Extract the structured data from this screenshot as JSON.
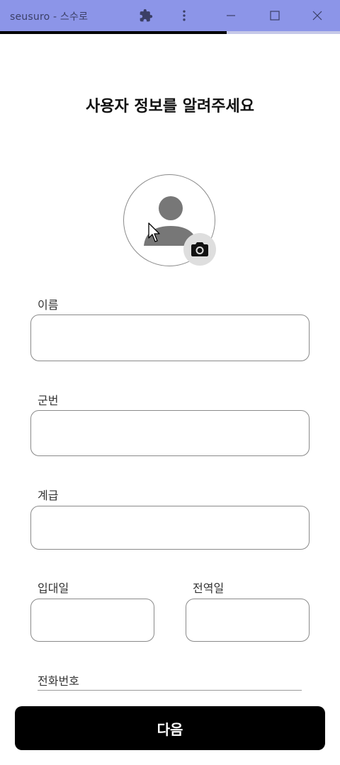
{
  "window": {
    "title": "seusuro - 스수로",
    "icons": [
      "puzzle-icon",
      "more-vert-icon",
      "minimize-icon",
      "maximize-icon",
      "close-icon"
    ]
  },
  "progress": {
    "fraction": 0.667
  },
  "page": {
    "heading": "사용자 정보를 알려주세요"
  },
  "avatar": {
    "icons": [
      "person-icon",
      "camera-icon"
    ]
  },
  "form": {
    "name_label": "이름",
    "name_value": "",
    "service_number_label": "군번",
    "service_number_value": "",
    "rank_label": "계급",
    "rank_value": "",
    "enlist_date_label": "입대일",
    "enlist_date_value": "",
    "discharge_date_label": "전역일",
    "discharge_date_value": "",
    "phone_label": "전화번호"
  },
  "actions": {
    "next_label": "다음"
  },
  "colors": {
    "titlebar": "#8c95e8",
    "progress": "#000000",
    "primary_button": "#000000"
  }
}
